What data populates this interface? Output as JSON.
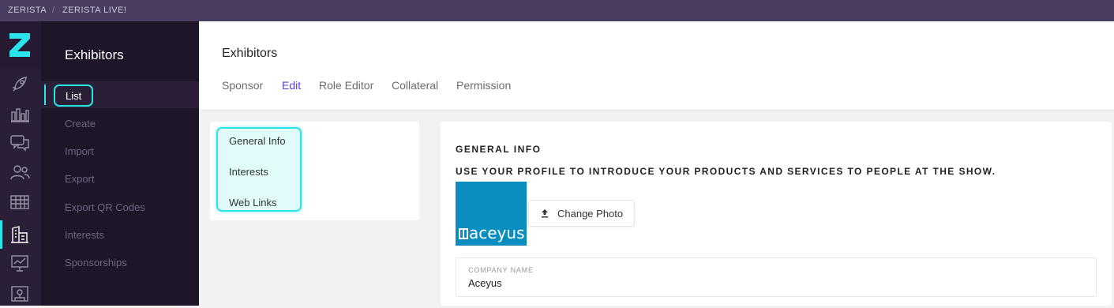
{
  "topbar": {
    "brand": "ZERISTA",
    "event": "ZERISTA LIVE!"
  },
  "icon_rail": {
    "logo": "zerista-logo-icon",
    "icons": [
      "rocket-icon",
      "bar-chart-icon",
      "chat-icon",
      "people-icon",
      "table-icon",
      "building-icon",
      "presentation-icon",
      "map-icon"
    ],
    "active": "building-icon"
  },
  "sidenav": {
    "title": "Exhibitors",
    "items": [
      {
        "label": "List"
      },
      {
        "label": "Create"
      },
      {
        "label": "Import"
      },
      {
        "label": "Export"
      },
      {
        "label": "Export QR Codes"
      },
      {
        "label": "Interests"
      },
      {
        "label": "Sponsorships"
      }
    ]
  },
  "header": {
    "title": "Exhibitors",
    "tabs": [
      {
        "label": "Sponsor"
      },
      {
        "label": "Edit"
      },
      {
        "label": "Role Editor"
      },
      {
        "label": "Collateral"
      },
      {
        "label": "Permission"
      }
    ],
    "active_tab": "Edit"
  },
  "sections": [
    "General Info",
    "Interests",
    "Web Links"
  ],
  "general_info": {
    "title": "GENERAL INFO",
    "subtitle": "USE YOUR PROFILE TO INTRODUCE YOUR PRODUCTS AND SERVICES TO PEOPLE AT THE SHOW.",
    "logo_text": "aceyus",
    "change_photo_label": "Change Photo",
    "company_name_label": "COMPANY NAME",
    "company_name_value": "Aceyus"
  },
  "colors": {
    "accent": "#2be3ea",
    "active_tab": "#5b3fd8",
    "sidebar": "#1f1529",
    "topbar": "#4b3d5f",
    "logo_bg": "#0a8ec0"
  }
}
